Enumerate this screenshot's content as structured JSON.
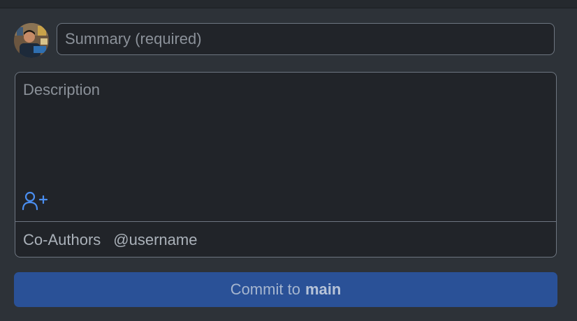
{
  "summary": {
    "placeholder": "Summary (required)",
    "value": ""
  },
  "description": {
    "placeholder": "Description",
    "value": ""
  },
  "coauthors": {
    "label": "Co-Authors",
    "placeholder": "@username",
    "icon": "add-user-icon"
  },
  "commit": {
    "prefix": "Commit to",
    "branch": "main"
  },
  "colors": {
    "background": "#2d3238",
    "field_background": "#212429",
    "field_border": "#6e7681",
    "accent_icon": "#4a8ef0",
    "commit_button": "#2a5197"
  }
}
